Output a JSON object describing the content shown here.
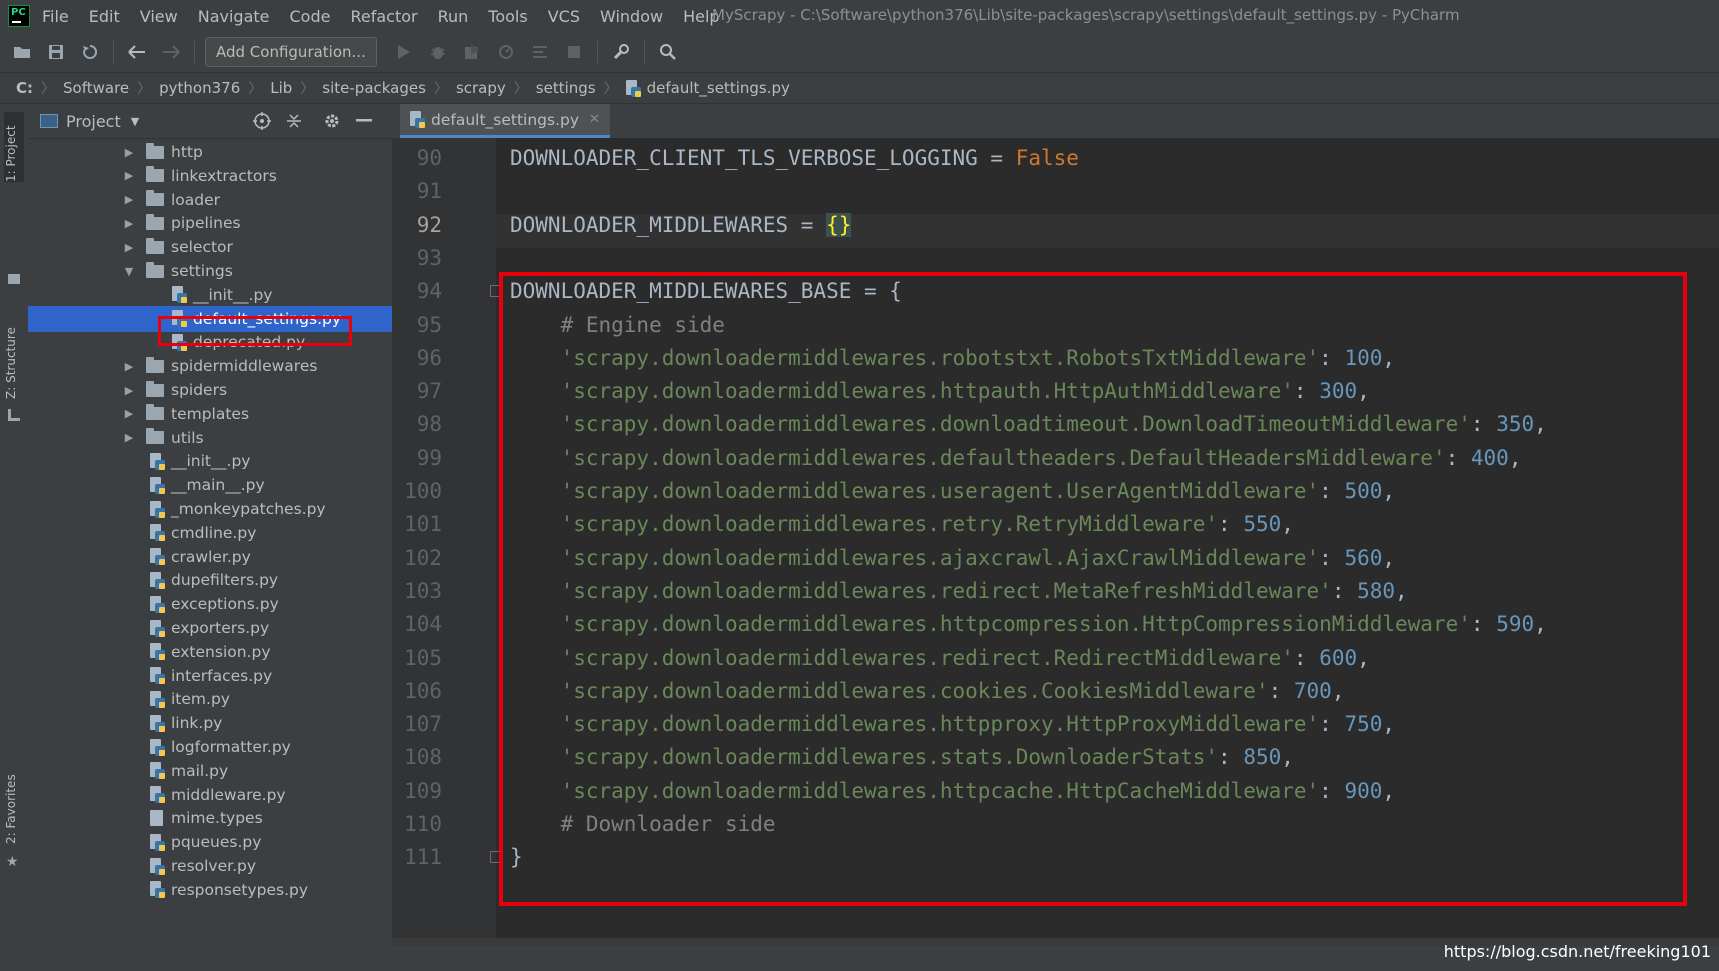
{
  "window": {
    "title": "MyScrapy - C:\\Software\\python376\\Lib\\site-packages\\scrapy\\settings\\default_settings.py - PyCharm"
  },
  "menu": [
    "File",
    "Edit",
    "View",
    "Navigate",
    "Code",
    "Refactor",
    "Run",
    "Tools",
    "VCS",
    "Window",
    "Help"
  ],
  "toolbar": {
    "add_configuration_label": "Add Configuration..."
  },
  "breadcrumb": [
    "C:",
    "Software",
    "python376",
    "Lib",
    "site-packages",
    "scrapy",
    "settings",
    "default_settings.py"
  ],
  "tool_strip": {
    "project_tab": "1: Project",
    "structure_tab": "Z: Structure",
    "favorites_tab": "2: Favorites"
  },
  "project_panel": {
    "title": "Project",
    "items": [
      {
        "label": "http",
        "type": "folder",
        "expanded": false,
        "depth": 1
      },
      {
        "label": "linkextractors",
        "type": "folder",
        "expanded": false,
        "depth": 1
      },
      {
        "label": "loader",
        "type": "folder",
        "expanded": false,
        "depth": 1
      },
      {
        "label": "pipelines",
        "type": "folder",
        "expanded": false,
        "depth": 1
      },
      {
        "label": "selector",
        "type": "folder",
        "expanded": false,
        "depth": 1
      },
      {
        "label": "settings",
        "type": "folder",
        "expanded": true,
        "depth": 1
      },
      {
        "label": "__init__.py",
        "type": "py",
        "depth": 2
      },
      {
        "label": "default_settings.py",
        "type": "py",
        "depth": 2,
        "selected": true
      },
      {
        "label": "deprecated.py",
        "type": "py",
        "depth": 2
      },
      {
        "label": "spidermiddlewares",
        "type": "folder",
        "expanded": false,
        "depth": 1
      },
      {
        "label": "spiders",
        "type": "folder",
        "expanded": false,
        "depth": 1
      },
      {
        "label": "templates",
        "type": "folder",
        "expanded": false,
        "depth": 1
      },
      {
        "label": "utils",
        "type": "folder",
        "expanded": false,
        "depth": 1
      },
      {
        "label": "__init__.py",
        "type": "py",
        "depth": 1
      },
      {
        "label": "__main__.py",
        "type": "py",
        "depth": 1
      },
      {
        "label": "_monkeypatches.py",
        "type": "py",
        "depth": 1
      },
      {
        "label": "cmdline.py",
        "type": "py",
        "depth": 1
      },
      {
        "label": "crawler.py",
        "type": "py",
        "depth": 1
      },
      {
        "label": "dupefilters.py",
        "type": "py",
        "depth": 1
      },
      {
        "label": "exceptions.py",
        "type": "py",
        "depth": 1
      },
      {
        "label": "exporters.py",
        "type": "py",
        "depth": 1
      },
      {
        "label": "extension.py",
        "type": "py",
        "depth": 1
      },
      {
        "label": "interfaces.py",
        "type": "py",
        "depth": 1
      },
      {
        "label": "item.py",
        "type": "py",
        "depth": 1
      },
      {
        "label": "link.py",
        "type": "py",
        "depth": 1
      },
      {
        "label": "logformatter.py",
        "type": "py",
        "depth": 1
      },
      {
        "label": "mail.py",
        "type": "py",
        "depth": 1
      },
      {
        "label": "middleware.py",
        "type": "py",
        "depth": 1
      },
      {
        "label": "mime.types",
        "type": "text",
        "depth": 1
      },
      {
        "label": "pqueues.py",
        "type": "py",
        "depth": 1
      },
      {
        "label": "resolver.py",
        "type": "py",
        "depth": 1
      },
      {
        "label": "responsetypes.py",
        "type": "py",
        "depth": 1
      }
    ]
  },
  "editor": {
    "tab_label": "default_settings.py",
    "current_line": 92,
    "lines": [
      {
        "n": "90",
        "tokens": [
          {
            "t": "DOWNLOADER_CLIENT_TLS_VERBOSE_LOGGING = ",
            "c": "plain"
          },
          {
            "t": "False",
            "c": "kw"
          }
        ]
      },
      {
        "n": "91",
        "tokens": []
      },
      {
        "n": "92",
        "tokens": [
          {
            "t": "DOWNLOADER_MIDDLEWARES = ",
            "c": "plain"
          },
          {
            "t": "{}",
            "c": "brace"
          }
        ]
      },
      {
        "n": "93",
        "tokens": []
      },
      {
        "n": "94",
        "tokens": [
          {
            "t": "DOWNLOADER_MIDDLEWARES_BASE = {",
            "c": "plain"
          }
        ]
      },
      {
        "n": "95",
        "tokens": [
          {
            "t": "    ",
            "c": "plain"
          },
          {
            "t": "# Engine side",
            "c": "cmt"
          }
        ]
      },
      {
        "n": "96",
        "tokens": [
          {
            "t": "    ",
            "c": "plain"
          },
          {
            "t": "'scrapy.downloadermiddlewares.robotstxt.RobotsTxtMiddleware'",
            "c": "str"
          },
          {
            "t": ": ",
            "c": "plain"
          },
          {
            "t": "100",
            "c": "num"
          },
          {
            "t": ",",
            "c": "plain"
          }
        ]
      },
      {
        "n": "97",
        "tokens": [
          {
            "t": "    ",
            "c": "plain"
          },
          {
            "t": "'scrapy.downloadermiddlewares.httpauth.HttpAuthMiddleware'",
            "c": "str"
          },
          {
            "t": ": ",
            "c": "plain"
          },
          {
            "t": "300",
            "c": "num"
          },
          {
            "t": ",",
            "c": "plain"
          }
        ]
      },
      {
        "n": "98",
        "tokens": [
          {
            "t": "    ",
            "c": "plain"
          },
          {
            "t": "'scrapy.downloadermiddlewares.downloadtimeout.DownloadTimeoutMiddleware'",
            "c": "str"
          },
          {
            "t": ": ",
            "c": "plain"
          },
          {
            "t": "350",
            "c": "num"
          },
          {
            "t": ",",
            "c": "plain"
          }
        ]
      },
      {
        "n": "99",
        "tokens": [
          {
            "t": "    ",
            "c": "plain"
          },
          {
            "t": "'scrapy.downloadermiddlewares.defaultheaders.DefaultHeadersMiddleware'",
            "c": "str"
          },
          {
            "t": ": ",
            "c": "plain"
          },
          {
            "t": "400",
            "c": "num"
          },
          {
            "t": ",",
            "c": "plain"
          }
        ]
      },
      {
        "n": "100",
        "tokens": [
          {
            "t": "    ",
            "c": "plain"
          },
          {
            "t": "'scrapy.downloadermiddlewares.useragent.UserAgentMiddleware'",
            "c": "str"
          },
          {
            "t": ": ",
            "c": "plain"
          },
          {
            "t": "500",
            "c": "num"
          },
          {
            "t": ",",
            "c": "plain"
          }
        ]
      },
      {
        "n": "101",
        "tokens": [
          {
            "t": "    ",
            "c": "plain"
          },
          {
            "t": "'scrapy.downloadermiddlewares.retry.RetryMiddleware'",
            "c": "str"
          },
          {
            "t": ": ",
            "c": "plain"
          },
          {
            "t": "550",
            "c": "num"
          },
          {
            "t": ",",
            "c": "plain"
          }
        ]
      },
      {
        "n": "102",
        "tokens": [
          {
            "t": "    ",
            "c": "plain"
          },
          {
            "t": "'scrapy.downloadermiddlewares.ajaxcrawl.AjaxCrawlMiddleware'",
            "c": "str"
          },
          {
            "t": ": ",
            "c": "plain"
          },
          {
            "t": "560",
            "c": "num"
          },
          {
            "t": ",",
            "c": "plain"
          }
        ]
      },
      {
        "n": "103",
        "tokens": [
          {
            "t": "    ",
            "c": "plain"
          },
          {
            "t": "'scrapy.downloadermiddlewares.redirect.MetaRefreshMiddleware'",
            "c": "str"
          },
          {
            "t": ": ",
            "c": "plain"
          },
          {
            "t": "580",
            "c": "num"
          },
          {
            "t": ",",
            "c": "plain"
          }
        ]
      },
      {
        "n": "104",
        "tokens": [
          {
            "t": "    ",
            "c": "plain"
          },
          {
            "t": "'scrapy.downloadermiddlewares.httpcompression.HttpCompressionMiddleware'",
            "c": "str"
          },
          {
            "t": ": ",
            "c": "plain"
          },
          {
            "t": "590",
            "c": "num"
          },
          {
            "t": ",",
            "c": "plain"
          }
        ]
      },
      {
        "n": "105",
        "tokens": [
          {
            "t": "    ",
            "c": "plain"
          },
          {
            "t": "'scrapy.downloadermiddlewares.redirect.RedirectMiddleware'",
            "c": "str"
          },
          {
            "t": ": ",
            "c": "plain"
          },
          {
            "t": "600",
            "c": "num"
          },
          {
            "t": ",",
            "c": "plain"
          }
        ]
      },
      {
        "n": "106",
        "tokens": [
          {
            "t": "    ",
            "c": "plain"
          },
          {
            "t": "'scrapy.downloadermiddlewares.cookies.CookiesMiddleware'",
            "c": "str"
          },
          {
            "t": ": ",
            "c": "plain"
          },
          {
            "t": "700",
            "c": "num"
          },
          {
            "t": ",",
            "c": "plain"
          }
        ]
      },
      {
        "n": "107",
        "tokens": [
          {
            "t": "    ",
            "c": "plain"
          },
          {
            "t": "'scrapy.downloadermiddlewares.httpproxy.HttpProxyMiddleware'",
            "c": "str"
          },
          {
            "t": ": ",
            "c": "plain"
          },
          {
            "t": "750",
            "c": "num"
          },
          {
            "t": ",",
            "c": "plain"
          }
        ]
      },
      {
        "n": "108",
        "tokens": [
          {
            "t": "    ",
            "c": "plain"
          },
          {
            "t": "'scrapy.downloadermiddlewares.stats.DownloaderStats'",
            "c": "str"
          },
          {
            "t": ": ",
            "c": "plain"
          },
          {
            "t": "850",
            "c": "num"
          },
          {
            "t": ",",
            "c": "plain"
          }
        ]
      },
      {
        "n": "109",
        "tokens": [
          {
            "t": "    ",
            "c": "plain"
          },
          {
            "t": "'scrapy.downloadermiddlewares.httpcache.HttpCacheMiddleware'",
            "c": "str"
          },
          {
            "t": ": ",
            "c": "plain"
          },
          {
            "t": "900",
            "c": "num"
          },
          {
            "t": ",",
            "c": "plain"
          }
        ]
      },
      {
        "n": "110",
        "tokens": [
          {
            "t": "    ",
            "c": "plain"
          },
          {
            "t": "# Downloader side",
            "c": "cmt"
          }
        ]
      },
      {
        "n": "111",
        "tokens": [
          {
            "t": "}",
            "c": "plain"
          }
        ]
      }
    ]
  },
  "watermark": "https://blog.csdn.net/freeking101",
  "colors": {
    "highlight_box": "#e8000d",
    "selection": "#2f65ca",
    "string": "#6a8759",
    "number": "#6897bb",
    "keyword": "#cc7832",
    "comment": "#808080"
  }
}
